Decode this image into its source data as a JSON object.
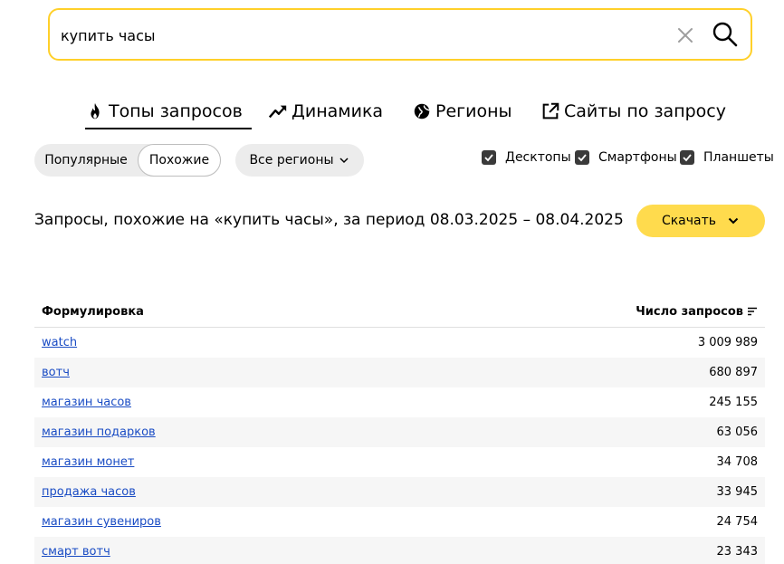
{
  "search": {
    "value": "купить часы"
  },
  "tabs": [
    {
      "label": "Топы запросов",
      "icon": "fire-icon",
      "active": true
    },
    {
      "label": "Динамика",
      "icon": "trend-up-icon"
    },
    {
      "label": "Регионы",
      "icon": "globe-icon"
    },
    {
      "label": "Сайты по запросу",
      "icon": "external-link-icon"
    }
  ],
  "filters": {
    "segment": [
      {
        "label": "Популярные",
        "active": false
      },
      {
        "label": "Похожие",
        "active": true
      }
    ],
    "region": "Все регионы",
    "devices": [
      {
        "label": "Десктопы",
        "checked": true
      },
      {
        "label": "Смартфоны",
        "checked": true
      },
      {
        "label": "Планшеты",
        "checked": true
      }
    ]
  },
  "heading": {
    "title": "Запросы, похожие на «купить часы», за период 08.03.2025 – 08.04.2025",
    "download": "Скачать"
  },
  "table": {
    "col_phrase": "Формулировка",
    "col_count": "Число запросов",
    "rows": [
      {
        "phrase": "watch",
        "count": "3 009 989"
      },
      {
        "phrase": "вотч",
        "count": "680 897"
      },
      {
        "phrase": "магазин часов",
        "count": "245 155"
      },
      {
        "phrase": "магазин подарков",
        "count": "63 056"
      },
      {
        "phrase": "магазин монет",
        "count": "34 708"
      },
      {
        "phrase": "продажа часов",
        "count": "33 945"
      },
      {
        "phrase": "магазин сувениров",
        "count": "24 754"
      },
      {
        "phrase": "смарт вотч",
        "count": "23 343"
      }
    ]
  },
  "colors": {
    "accent_yellow": "#ffdb4d",
    "search_border": "#ffd02a",
    "link": "#1a4cc4"
  }
}
